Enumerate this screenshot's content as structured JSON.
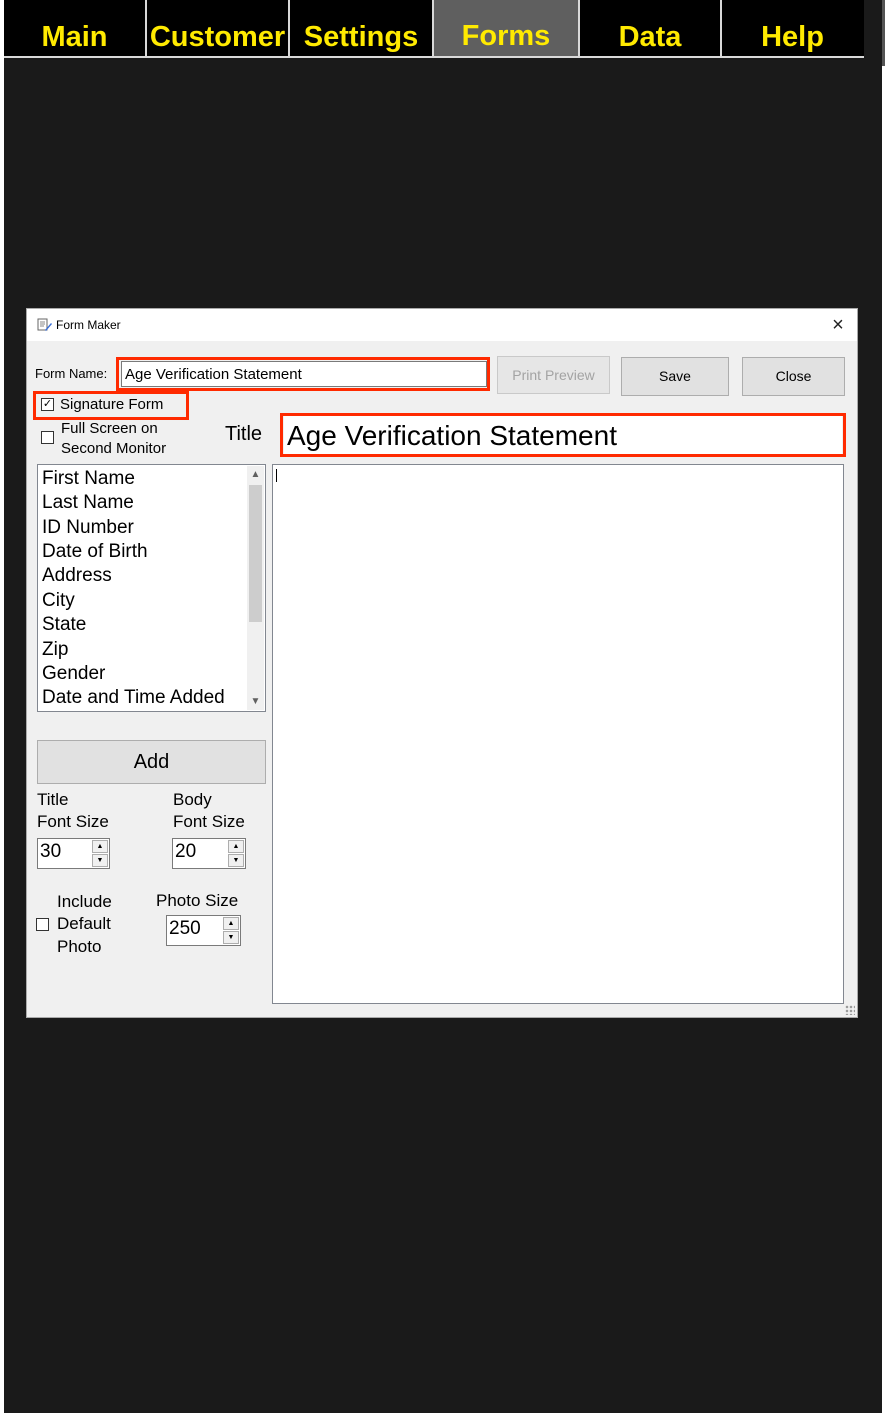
{
  "menu": {
    "tabs": [
      {
        "label": "Main"
      },
      {
        "label": "Customer"
      },
      {
        "label": "Settings"
      },
      {
        "label": "Forms"
      },
      {
        "label": "Data"
      },
      {
        "label": "Help"
      }
    ],
    "active": "Forms",
    "text_color": "#ffea00",
    "active_bg": "#5f5f5f"
  },
  "dialog": {
    "title": "Form Maker",
    "close_glyph": "×",
    "form_name_label": "Form Name:",
    "form_name_value": "Age Verification Statement",
    "print_preview_label": "Print Preview",
    "save_label": "Save",
    "close_label": "Close",
    "signature_form_label": "Signature Form",
    "signature_form_checked": true,
    "full_screen_label_1": "Full Screen on",
    "full_screen_label_2": "Second Monitor",
    "full_screen_checked": false,
    "title_label": "Title",
    "title_value": "Age Verification Statement",
    "fields": [
      "First Name",
      "Last Name",
      "ID Number",
      "Date of Birth",
      "Address",
      "City",
      "State",
      "Zip",
      "Gender",
      "Date and Time Added"
    ],
    "add_label": "Add",
    "title_font_label_1": "Title",
    "title_font_label_2": "Font Size",
    "title_font_value": "30",
    "body_font_label_1": "Body",
    "body_font_label_2": "Font Size",
    "body_font_value": "20",
    "include_photo_label_1": "Include",
    "include_photo_label_2": "Default",
    "include_photo_label_3": "Photo",
    "include_photo_checked": false,
    "photo_size_label": "Photo Size",
    "photo_size_value": "250",
    "body_text": "",
    "highlight_color": "#ff2a00"
  }
}
